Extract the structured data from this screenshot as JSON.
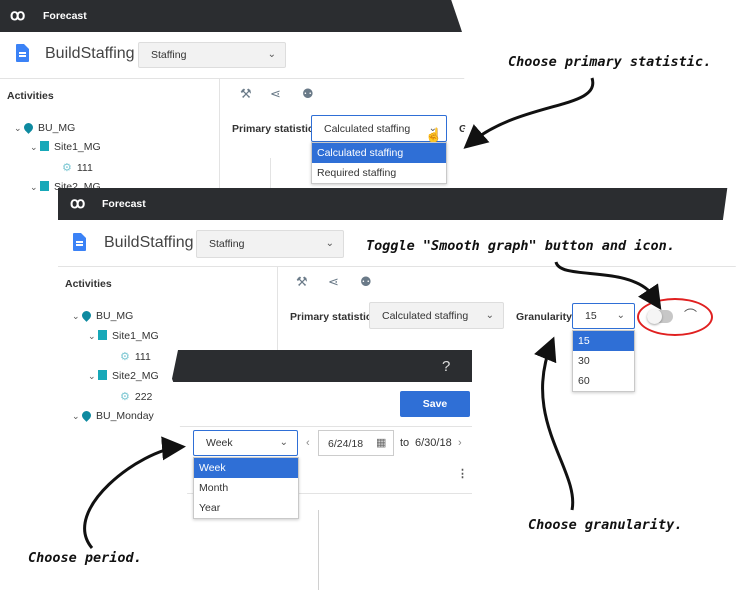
{
  "screen1": {
    "app_title": "Forecast",
    "page_title": "BuildStaffing",
    "view_select": "Staffing",
    "activities_header": "Activities",
    "tree": [
      "BU_MG",
      "Site1_MG",
      "111",
      "Site2_MG"
    ],
    "primary_statistic_label": "Primary statistic",
    "primary_statistic_value": "Calculated staffing",
    "granularity_label": "Granu",
    "statistic_options": [
      "Calculated staffing",
      "Required staffing"
    ]
  },
  "screen2": {
    "app_title": "Forecast",
    "page_title": "BuildStaffing",
    "view_select": "Staffing",
    "activities_header": "Activities",
    "tree": [
      "BU_MG",
      "Site1_MG",
      "111",
      "Site2_MG",
      "222",
      "BU_Monday"
    ],
    "primary_statistic_label": "Primary statistic",
    "primary_statistic_value": "Calculated staffing",
    "granularity_label": "Granularity",
    "granularity_value": "15",
    "granularity_options": [
      "15",
      "30",
      "60"
    ]
  },
  "screen3": {
    "help": "?",
    "save_label": "Save",
    "period_value": "Week",
    "period_options": [
      "Week",
      "Month",
      "Year"
    ],
    "date_from": "6/24/18",
    "date_to_label": "to",
    "date_to": "6/30/18"
  },
  "annotations": {
    "primary": "Choose primary statistic.",
    "smooth": "Toggle \"Smooth graph\" button and icon.",
    "granularity": "Choose granularity.",
    "period": "Choose period."
  },
  "colors": {
    "topbar": "#2b2d30",
    "accent": "#2f6fd6",
    "highlight_circle": "#e02020"
  }
}
